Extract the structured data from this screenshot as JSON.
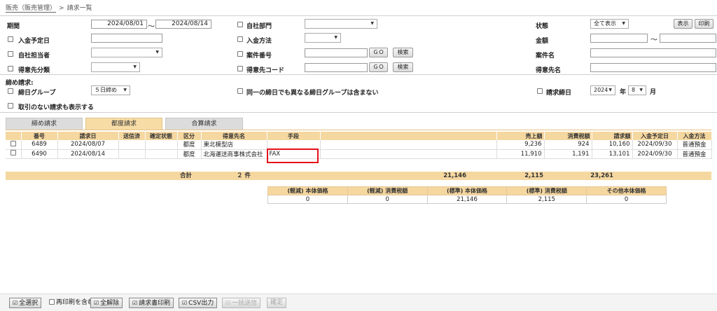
{
  "breadcrumb": {
    "parent": "販売（販売管理）",
    "separator": ">",
    "current": "請求一覧"
  },
  "filters": {
    "period_label": "期間",
    "period_from": "2024/08/01",
    "period_tilde": "～",
    "period_to": "2024/08/14",
    "planned_payment_label": "入金予定日",
    "own_staff_label": "自社担当者",
    "customer_class_label": "得意先分類",
    "own_dept_label": "自社部門",
    "payment_method_label": "入金方法",
    "case_no_label": "案件番号",
    "customer_code_label": "得意先コード",
    "go_label": "ＧＯ",
    "search_label": "検索",
    "status_label": "状態",
    "status_value": "全て表示",
    "show_button": "表示",
    "print_button": "印刷",
    "amount_label": "金額",
    "amount_tilde": "～",
    "case_name_label": "案件名",
    "customer_name_label": "得意先名",
    "closing_section": "締め請求:",
    "closing_group_label": "締日グループ",
    "closing_group_value": "５日締め",
    "same_day_label": "同一の締日でも異なる締日グループは含まない",
    "billing_day_label": "請求締日",
    "billing_year": "2024",
    "year_unit": "年",
    "billing_month": "8",
    "month_unit": "月",
    "no_trade_label": "取引のない請求も表示する"
  },
  "tabs": [
    "締め請求",
    "都度請求",
    "合算請求"
  ],
  "table": {
    "headers": [
      "番号",
      "請求日",
      "送信済",
      "確定状態",
      "区分",
      "得意先名",
      "手段",
      "",
      "売上額",
      "消費税額",
      "請求額",
      "入金予定日",
      "入金方法"
    ],
    "rows": [
      {
        "no": "6489",
        "date": "2024/08/07",
        "sent": "",
        "confirmed": "",
        "kubun": "都度",
        "customer": "東北模型店",
        "method": "",
        "sales": "9,236",
        "tax": "924",
        "billing": "10,160",
        "due": "2024/09/30",
        "pay": "普通預金"
      },
      {
        "no": "6490",
        "date": "2024/08/14",
        "sent": "",
        "confirmed": "",
        "kubun": "都度",
        "customer": "北海運送商事株式会社",
        "method": "FAX",
        "sales": "11,910",
        "tax": "1,191",
        "billing": "13,101",
        "due": "2024/09/30",
        "pay": "普通預金"
      }
    ]
  },
  "totals": {
    "label": "合計",
    "count": "２ 件",
    "sales": "21,146",
    "tax": "2,115",
    "billing": "23,261"
  },
  "summary": {
    "headers": [
      "(軽減) 本体価格",
      "(軽減) 消費税額",
      "(標準) 本体価格",
      "(標準) 消費税額",
      "その他本体価格"
    ],
    "values": [
      "0",
      "0",
      "21,146",
      "2,115",
      "0"
    ]
  },
  "bottom": {
    "select_all": "全選択",
    "include_reprint": "再印刷を含む",
    "deselect_all": "全解除",
    "print_invoice": "請求書印刷",
    "csv_output": "CSV出力",
    "bulk_send": "一括送信",
    "confirm": "確定"
  }
}
